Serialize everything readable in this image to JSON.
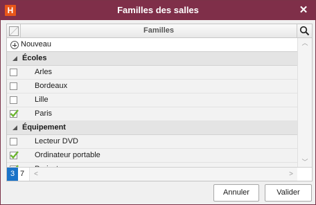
{
  "window": {
    "title": "Familles des salles",
    "app_icon_letter": "H"
  },
  "grid": {
    "column_header": "Familles",
    "new_row_label": "Nouveau",
    "groups": [
      {
        "label": "Écoles",
        "items": [
          {
            "label": "Arles",
            "checked": false
          },
          {
            "label": "Bordeaux",
            "checked": false
          },
          {
            "label": "Lille",
            "checked": false
          },
          {
            "label": "Paris",
            "checked": true
          }
        ]
      },
      {
        "label": "Équipement",
        "items": [
          {
            "label": "Lecteur DVD",
            "checked": false
          },
          {
            "label": "Ordinateur portable",
            "checked": true
          },
          {
            "label": "Projecteur",
            "checked": true
          }
        ]
      }
    ],
    "selected_count": "3",
    "total_count": "7"
  },
  "buttons": {
    "cancel": "Annuler",
    "ok": "Valider"
  },
  "colors": {
    "titlebar": "#7f2f49",
    "accent": "#e8561a",
    "check": "#6bb52f",
    "selection": "#1a73c8"
  },
  "icons": {
    "app": "app-logo-icon",
    "close": "close-icon",
    "search": "search-icon",
    "add": "plus-circle-icon",
    "expand": "triangle-down-icon",
    "check": "checkmark-icon"
  }
}
